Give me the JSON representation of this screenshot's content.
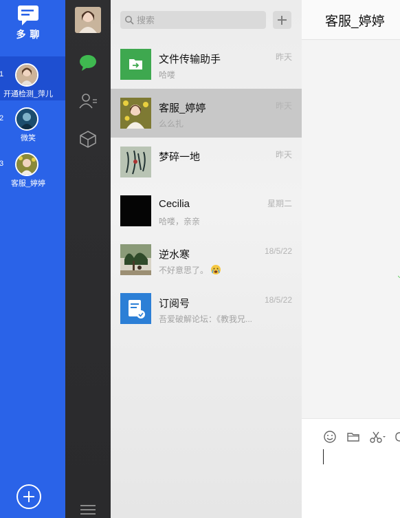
{
  "app": {
    "name": "多 聊"
  },
  "accounts": [
    {
      "index": "1",
      "name": "开通检测_萍儿",
      "avatar": "woman-portrait"
    },
    {
      "index": "2",
      "name": "微笑",
      "avatar": "teal-portrait"
    },
    {
      "index": "3",
      "name": "客服_婷婷",
      "avatar": "woman-yellow-flowers"
    }
  ],
  "nav": {
    "icons": [
      "chat-bubble",
      "contacts",
      "cube"
    ]
  },
  "search": {
    "placeholder": "搜索"
  },
  "chats": [
    {
      "name": "文件传输助手",
      "time": "昨天",
      "preview": "哈喽",
      "avatar": "file-transfer"
    },
    {
      "name": "客服_婷婷",
      "time": "昨天",
      "preview": "么么扎",
      "avatar": "woman-yellow-flowers",
      "selected": true
    },
    {
      "name": "梦碎一地",
      "time": "昨天",
      "preview": "",
      "avatar": "calligraphy"
    },
    {
      "name": "Cecilia",
      "time": "星期二",
      "preview": "哈喽，亲亲",
      "avatar": "black"
    },
    {
      "name": "逆水寒",
      "time": "18/5/22",
      "preview": "不好意思了。",
      "avatar": "tree-scene"
    },
    {
      "name": "订阅号",
      "time": "18/5/22",
      "preview": "吾爱破解论坛：《教我兄...",
      "avatar": "subscription"
    }
  ],
  "chat_window": {
    "title": "客服_婷婷",
    "toolbar": [
      "emoji",
      "folder",
      "scissors",
      "chat-history"
    ]
  },
  "colors": {
    "accent": "#2a63e8",
    "nav_bg": "#2e2e30",
    "selected_row": "#c8c8c8",
    "green": "#3fb950"
  }
}
